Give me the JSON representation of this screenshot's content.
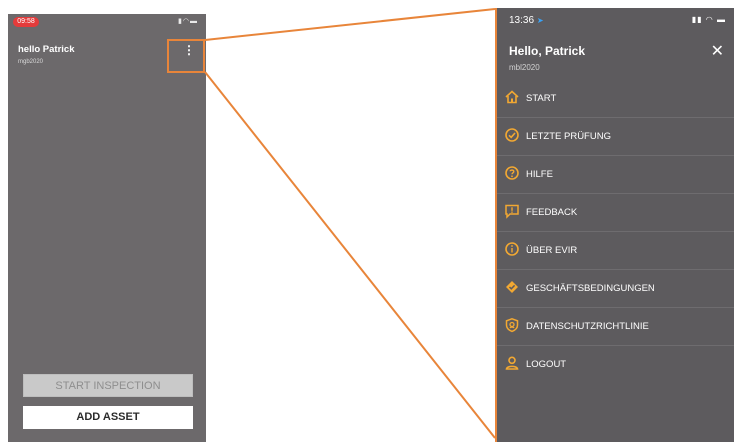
{
  "colors": {
    "accent": "#e8853a",
    "icon_yellow": "#f2a832",
    "phone_left_bg": "#6c696b",
    "phone_right_bg": "#5d5b5e"
  },
  "left_phone": {
    "status_time": "09:58",
    "greeting": "hello Patrick",
    "username": "mgb2020",
    "kebab_symbol": "⋮",
    "start_button_label": "START INSPECTION",
    "add_button_label": "ADD ASSET"
  },
  "right_phone": {
    "status_time": "13:36",
    "greeting": "Hello, Patrick",
    "username": "mbl2020",
    "close_symbol": "✕",
    "menu_items": [
      {
        "icon": "home-icon",
        "label": "START"
      },
      {
        "icon": "check-circle-icon",
        "label": "LETZTE PRÜFUNG"
      },
      {
        "icon": "help-icon",
        "label": "HILFE"
      },
      {
        "icon": "feedback-icon",
        "label": "FEEDBACK"
      },
      {
        "icon": "info-icon",
        "label": "ÜBER EVIR"
      },
      {
        "icon": "terms-icon",
        "label": "GESCHÄFTSBEDINGUNGEN"
      },
      {
        "icon": "privacy-shield-icon",
        "label": "DATENSCHUTZRICHTLINIE"
      },
      {
        "icon": "user-icon",
        "label": "LOGOUT"
      }
    ]
  }
}
